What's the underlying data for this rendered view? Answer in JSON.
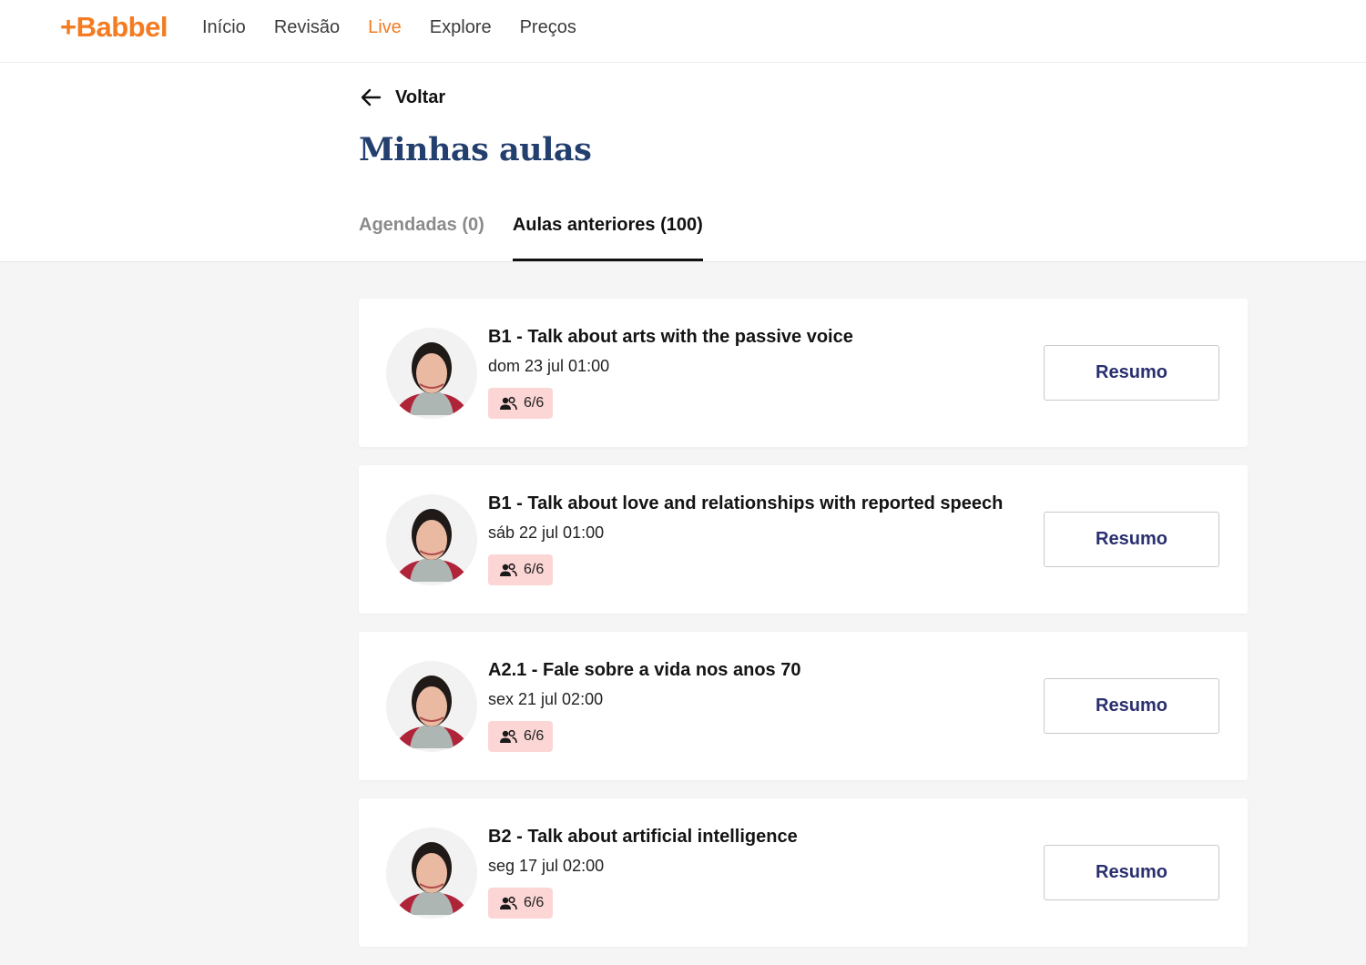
{
  "brand": {
    "logo": "+Babbel",
    "accent": "#f47b20",
    "title_color": "#233f6e",
    "badge_color": "#fcd5d5"
  },
  "nav": {
    "items": [
      {
        "label": "Início",
        "active": false
      },
      {
        "label": "Revisão",
        "active": false
      },
      {
        "label": "Live",
        "active": true
      },
      {
        "label": "Explore",
        "active": false
      },
      {
        "label": "Preços",
        "active": false
      }
    ]
  },
  "back": {
    "label": "Voltar",
    "icon": "arrow-left-icon"
  },
  "page": {
    "title": "Minhas aulas"
  },
  "tabs": [
    {
      "label": "Agendadas (0)",
      "active": false
    },
    {
      "label": "Aulas anteriores (100)",
      "active": true
    }
  ],
  "lessons": [
    {
      "title": "B1 - Talk about arts with the passive voice",
      "date": "dom 23 jul 01:00",
      "participants": "6/6",
      "button": "Resumo"
    },
    {
      "title": "B1 - Talk about love and relationships with reported speech",
      "date": "sáb 22 jul 01:00",
      "participants": "6/6",
      "button": "Resumo"
    },
    {
      "title": "A2.1 - Fale sobre a vida nos anos 70",
      "date": "sex 21 jul 02:00",
      "participants": "6/6",
      "button": "Resumo"
    },
    {
      "title": "B2 - Talk about artificial intelligence",
      "date": "seg 17 jul 02:00",
      "participants": "6/6",
      "button": "Resumo"
    }
  ]
}
